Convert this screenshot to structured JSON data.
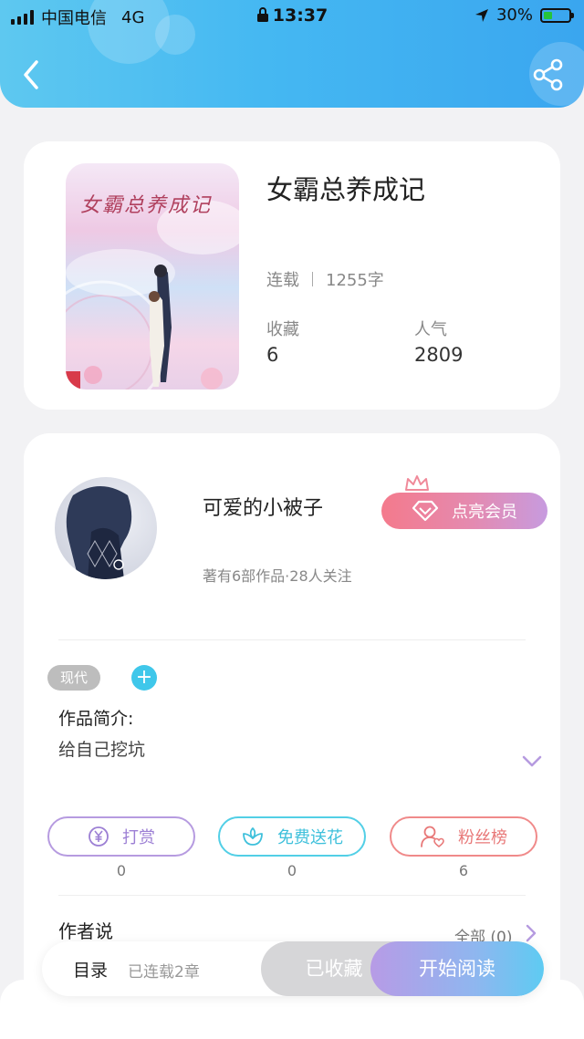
{
  "status_bar": {
    "carrier": "中国电信",
    "network": "4G",
    "time": "13:37",
    "battery": "30%"
  },
  "header": {
    "back_icon": "chevron-left-icon",
    "share_icon": "share-icon"
  },
  "book": {
    "cover_title": "女霸总养成记",
    "title": "女霸总养成记",
    "status": "连载",
    "word_count": "1255字",
    "favorites_label": "收藏",
    "favorites_value": "6",
    "popularity_label": "人气",
    "popularity_value": "2809"
  },
  "author": {
    "name": "可爱的小被子",
    "summary": "著有6部作品·28人关注",
    "vip_button": "点亮会员"
  },
  "tags": {
    "items": [
      "现代"
    ],
    "add": "+"
  },
  "intro": {
    "label": "作品简介:",
    "text": "给自己挖坑"
  },
  "actions": {
    "reward_label": "打赏",
    "reward_count": "0",
    "flower_label": "免费送花",
    "flower_count": "0",
    "fans_label": "粉丝榜",
    "fans_count": "6"
  },
  "author_says": {
    "label": "作者说",
    "all": "全部 (0)"
  },
  "bottom_bar": {
    "toc": "目录",
    "chapters": "已连载2章",
    "collected": "已收藏",
    "start_reading": "开始阅读"
  },
  "colors": {
    "header_blue": "#45b8f2",
    "vip_pink": "#f47a8c",
    "reward_purple": "#b69be0",
    "flower_cyan": "#52cfe6",
    "fans_red": "#f08a8a"
  }
}
